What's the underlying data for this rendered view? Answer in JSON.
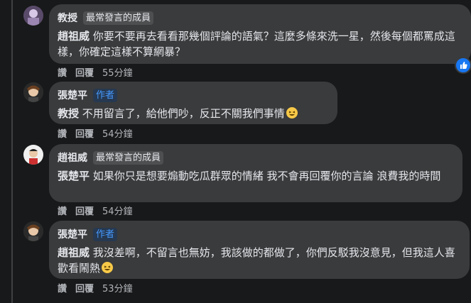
{
  "comments": [
    {
      "name": "教授",
      "badge": "最常發言的成員",
      "mention": "趙祖威",
      "text": " 你要不要再去看看那幾個評論的語氣？這麼多條來洗一星，然後每個都罵成這樣，你確定這樣不算網暴？",
      "time": "55分鐘"
    },
    {
      "name": "張楚平",
      "badge": "作者",
      "mention": "教授",
      "text": " 不用留言了，給他們吵，反正不關我們事情",
      "time": "54分鐘"
    },
    {
      "name": "趙祖威",
      "badge": "最常發言的成員",
      "mention": "張楚平",
      "text": " 如果你只是想要煽動吃瓜群眾的情緒 我不會再回覆你的言論 浪費我的時間",
      "time": "54分鐘"
    },
    {
      "name": "張楚平",
      "badge": "作者",
      "mention": "趙祖威",
      "text": " 我沒差啊，不留言也無妨，我該做的都做了，你們反駁我沒意見，但我這人喜歡看鬧熱",
      "time": "53分鐘"
    }
  ],
  "actions": {
    "like": "讚",
    "reply": "回覆"
  },
  "colors": {
    "background": "#18191a",
    "bubble": "#3a3b3c",
    "author_badge": "#4599ff",
    "like": "#1877f2"
  }
}
